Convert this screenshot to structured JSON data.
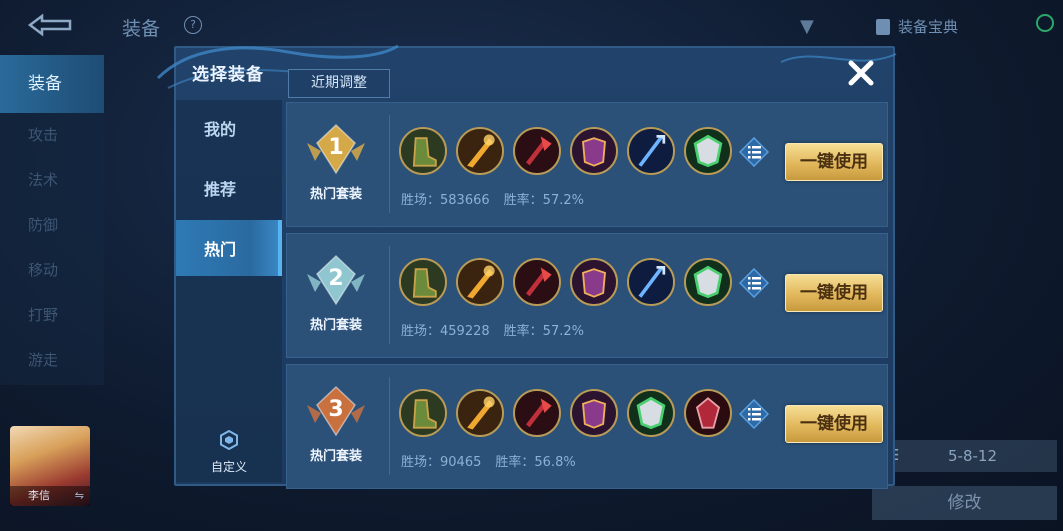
{
  "background": {
    "title": "装备",
    "help": "?",
    "codex_label": "装备宝典",
    "side_tabs": [
      "装备",
      "攻击",
      "法术",
      "防御",
      "移动",
      "打野",
      "游走"
    ],
    "hero_name": "李信",
    "hero_swap": "⇋",
    "build_code": "5-8-12",
    "modify_label": "修改"
  },
  "modal": {
    "title": "选择装备",
    "recent_tab": "近期调整",
    "left_tabs": [
      {
        "label": "我的"
      },
      {
        "label": "推荐"
      },
      {
        "label": "热门"
      }
    ],
    "active_tab": "热门",
    "custom_label": "自定义",
    "use_label": "一键使用",
    "builds": [
      {
        "rank": "1",
        "rank_color": "#d6a948",
        "label": "热门套装",
        "wins_label": "胜场：",
        "wins": "583666",
        "rate_label": "胜率：",
        "rate": "57.2%",
        "items": [
          "boots-icon",
          "golden-blade-icon",
          "crimson-axe-icon",
          "purple-armor-icon",
          "azure-spear-icon",
          "jade-shield-icon"
        ]
      },
      {
        "rank": "2",
        "rank_color": "#8fc6cf",
        "label": "热门套装",
        "wins_label": "胜场：",
        "wins": "459228",
        "rate_label": "胜率：",
        "rate": "57.2%",
        "items": [
          "boots-icon",
          "golden-blade-icon",
          "crimson-axe-icon",
          "purple-armor-icon",
          "azure-spear-icon",
          "jade-shield-icon"
        ]
      },
      {
        "rank": "3",
        "rank_color": "#c9703f",
        "label": "热门套装",
        "wins_label": "胜场：",
        "wins": "90465",
        "rate_label": "胜率：",
        "rate": "56.8%",
        "items": [
          "boots-icon",
          "golden-blade-icon",
          "crimson-axe-icon",
          "purple-armor-icon",
          "jade-shield-icon",
          "ruby-crystal-icon"
        ]
      }
    ]
  }
}
